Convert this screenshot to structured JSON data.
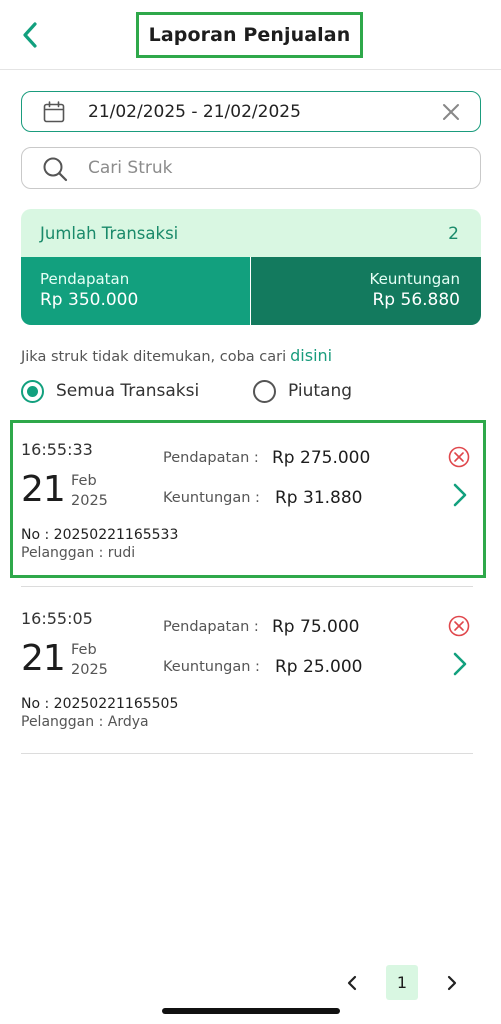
{
  "header": {
    "title": "Laporan Penjualan",
    "back_icon": "chevron-left-icon"
  },
  "filters": {
    "date_range": "21/02/2025 - 21/02/2025",
    "calendar_icon": "calendar-icon",
    "clear_icon": "close-icon",
    "search_placeholder": "Cari Struk",
    "search_value": ""
  },
  "summary": {
    "count_label": "Jumlah Transaksi",
    "count_value": "2",
    "revenue_label": "Pendapatan",
    "revenue_value": "Rp 350.000",
    "profit_label": "Keuntungan",
    "profit_value": "Rp 56.880"
  },
  "hint": {
    "text": "Jika struk tidak ditemukan, coba cari",
    "link": "disini"
  },
  "radios": {
    "all_label": "Semua Transaksi",
    "debt_label": "Piutang",
    "selected": "all"
  },
  "transactions": [
    {
      "time": "16:55:33",
      "day": "21",
      "month": "Feb",
      "year": "2025",
      "revenue_label": "Pendapatan :",
      "revenue_value": "Rp 275.000",
      "profit_label": "Keuntungan :",
      "profit_value": "Rp 31.880",
      "number": "No : 20250221165533",
      "customer": "Pelanggan : rudi"
    },
    {
      "time": "16:55:05",
      "day": "21",
      "month": "Feb",
      "year": "2025",
      "revenue_label": "Pendapatan :",
      "revenue_value": "Rp 75.000",
      "profit_label": "Keuntungan :",
      "profit_value": "Rp 25.000",
      "number": "No : 20250221165505",
      "customer": "Pelanggan : Ardya"
    }
  ],
  "pagination": {
    "current_page": "1"
  },
  "colors": {
    "primary": "#12a07e",
    "primary_dark": "#137a5e",
    "primary_light": "#d9f7e2",
    "highlight": "#2ea84a",
    "delete": "#e0474c"
  }
}
